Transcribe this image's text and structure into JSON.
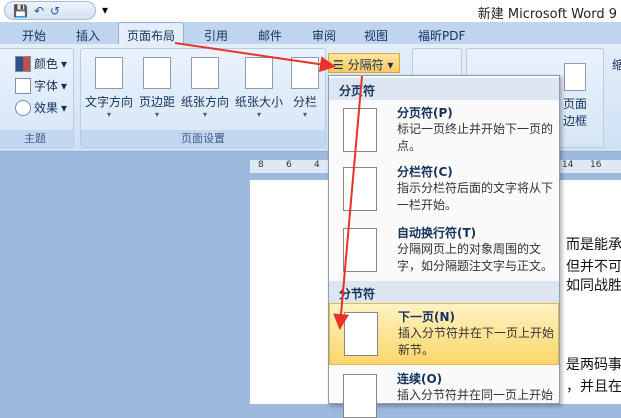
{
  "title": "新建 Microsoft Word 9",
  "qat": {
    "save": "💾",
    "undo": "↶",
    "redo": "↺",
    "more": "▾"
  },
  "tabs": [
    "开始",
    "插入",
    "页面布局",
    "引用",
    "邮件",
    "审阅",
    "视图",
    "福昕PDF"
  ],
  "theme_group": {
    "label": "主题",
    "colors": "颜色",
    "fonts": "字体",
    "effects": "效果"
  },
  "page_setup": {
    "label": "页面设置",
    "buttons": [
      "文字方向",
      "页边距",
      "纸张方向",
      "纸张大小",
      "分栏"
    ],
    "breaks": "分隔符"
  },
  "right_ribbon": {
    "page_border": "页面",
    "page_border2": "边框",
    "indent": "缩"
  },
  "ruler": [
    "8",
    "6",
    "4",
    "14",
    "16"
  ],
  "menu": {
    "section1": "分页符",
    "items1": [
      {
        "title": "分页符(P)",
        "desc": "标记一页终止并开始下一页的点。"
      },
      {
        "title": "分栏符(C)",
        "desc": "指示分栏符后面的文字将从下一栏开始。"
      },
      {
        "title": "自动换行符(T)",
        "desc": "分隔网页上的对象周围的文字，如分隔题注文字与正文。"
      }
    ],
    "section2": "分节符",
    "items2": [
      {
        "title": "下一页(N)",
        "desc": "插入分节符并在下一页上开始新节。"
      },
      {
        "title": "连续(O)",
        "desc": "插入分节符并在同一页上开始"
      }
    ]
  },
  "doc_lines": [
    "而是能承受",
    "但并不可怕",
    "如同战胜黑",
    "是两码事",
    "，并且在"
  ]
}
